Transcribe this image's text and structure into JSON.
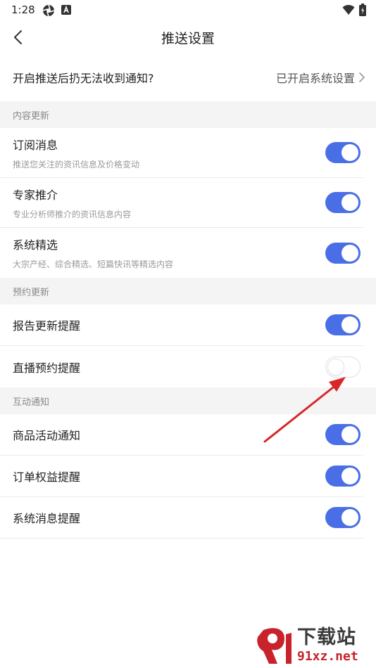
{
  "status_bar": {
    "time": "1:28",
    "icons_left": [
      "aperture-icon",
      "a-box-icon"
    ],
    "icons_right": [
      "wifi-icon",
      "battery-icon"
    ]
  },
  "nav": {
    "title": "推送设置",
    "back_icon": "chevron-left-icon"
  },
  "notice": {
    "text": "开启推送后扔无法收到通知?",
    "link": "已开启系统设置",
    "chevron_icon": "chevron-right-icon"
  },
  "sections": [
    {
      "header": "内容更新",
      "items": [
        {
          "title": "订阅消息",
          "subtitle": "推送您关注的资讯信息及价格变动",
          "enabled": true
        },
        {
          "title": "专家推介",
          "subtitle": "专业分析师推介的资讯信息内容",
          "enabled": true
        },
        {
          "title": "系统精选",
          "subtitle": "大宗产经、综合精选、短篇快讯等精选内容",
          "enabled": true
        }
      ]
    },
    {
      "header": "预约更新",
      "items": [
        {
          "title": "报告更新提醒",
          "enabled": true
        },
        {
          "title": "直播预约提醒",
          "enabled": false
        }
      ]
    },
    {
      "header": "互动通知",
      "items": [
        {
          "title": "商品活动通知",
          "enabled": true
        },
        {
          "title": "订单权益提醒",
          "enabled": true
        },
        {
          "title": "系统消息提醒",
          "enabled": true
        }
      ]
    }
  ],
  "colors": {
    "toggle_on": "#4a6ee6",
    "section_bg": "#f4f4f4",
    "annotation_arrow": "#d8262b"
  },
  "watermark": {
    "text_cn": "下载站",
    "text_url": "91xz.net"
  }
}
